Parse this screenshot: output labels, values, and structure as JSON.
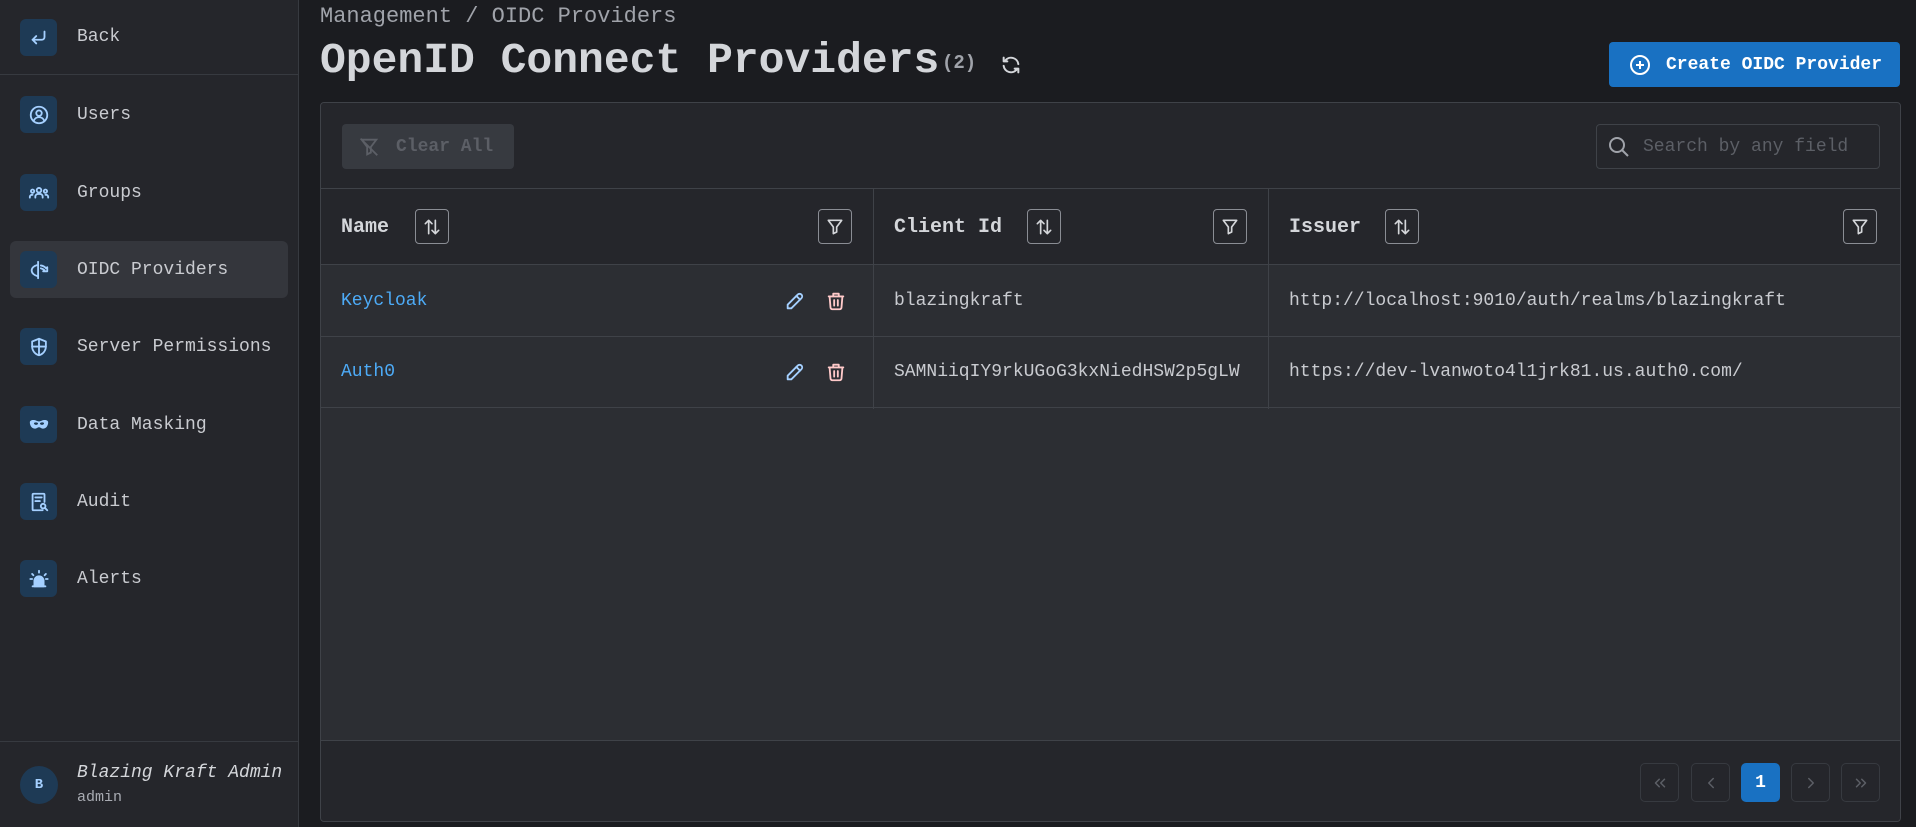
{
  "sidebar": {
    "back_label": "Back",
    "items": [
      {
        "label": "Users",
        "icon": "user-circle-icon"
      },
      {
        "label": "Groups",
        "icon": "users-group-icon"
      },
      {
        "label": "OIDC Providers",
        "icon": "openid-icon",
        "active": true
      },
      {
        "label": "Server Permissions",
        "icon": "shield-icon"
      },
      {
        "label": "Data Masking",
        "icon": "mask-icon"
      },
      {
        "label": "Audit",
        "icon": "report-icon"
      },
      {
        "label": "Alerts",
        "icon": "alarm-icon"
      }
    ],
    "user": {
      "initial": "B",
      "name": "Blazing Kraft Admin",
      "role": "admin"
    }
  },
  "header": {
    "breadcrumb": "Management / OIDC Providers",
    "title": "OpenID Connect Providers",
    "count": "(2)",
    "create_label": "Create OIDC Provider"
  },
  "toolbar": {
    "clear_label": "Clear All",
    "search_placeholder": "Search by any field"
  },
  "table": {
    "columns": [
      "Name",
      "Client Id",
      "Issuer"
    ],
    "rows": [
      {
        "name": "Keycloak",
        "client_id": "blazingkraft",
        "issuer": "http://localhost:9010/auth/realms/blazingkraft"
      },
      {
        "name": "Auth0",
        "client_id": "SAMNiiqIY9rkUGoG3kxNiedHSW2p5gLW",
        "issuer": "https://dev-lvanwoto4l1jrk81.us.auth0.com/"
      }
    ]
  },
  "pagination": {
    "current_page": "1"
  },
  "colors": {
    "accent": "#1971c2",
    "link": "#4dabf7",
    "background": "#1b1c20",
    "sidebar": "#25262b"
  }
}
